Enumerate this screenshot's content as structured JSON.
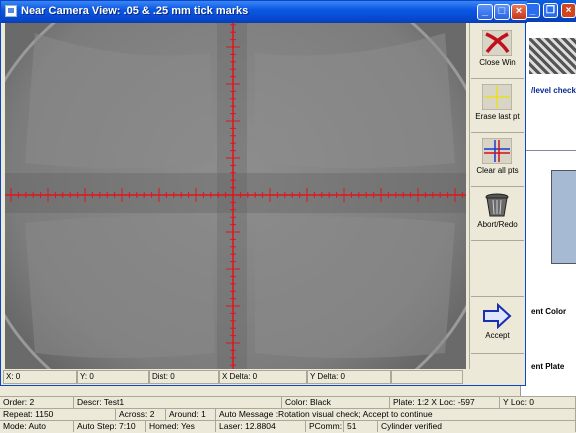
{
  "window": {
    "title": "Near Camera View: .05 & .25 mm tick marks",
    "controls": {
      "minimize": "_",
      "maximize": "□",
      "close": "×"
    }
  },
  "background_app": {
    "controls": {
      "minimize": "_",
      "restore": "❐",
      "close": "×"
    },
    "labels": [
      "/level check",
      "ent Color",
      "ent Plate"
    ]
  },
  "toolbar": {
    "close_label": "Close Win",
    "erase_label": "Erase last pt",
    "clear_label": "Clear all pts",
    "abort_label": "Abort/Redo",
    "accept_label": "Accept"
  },
  "coords": {
    "x": "X: 0",
    "y": "Y: 0",
    "dist": "Dist: 0",
    "x_delta": "X Delta: 0",
    "y_delta": "Y Delta: 0"
  },
  "status": {
    "row1": [
      "Order: 2",
      "Descr: Test1",
      "Color: Black",
      "Plate: 1:2 X Loc: -597",
      "Y Loc: 0"
    ],
    "row2": [
      "Repeat: 1150",
      "Across: 2",
      "Around: 1",
      "Auto Message :Rotation visual check; Accept to continue"
    ],
    "row3": [
      "Mode: Auto",
      "Auto Step: 7:10",
      "Homed: Yes",
      "Laser: 12.8804",
      "PComm:",
      "51",
      "Cylinder verified"
    ]
  },
  "colors": {
    "crosshair": "#e0141e",
    "titlebar": "#0b58e3",
    "face": "#ece9d8"
  }
}
